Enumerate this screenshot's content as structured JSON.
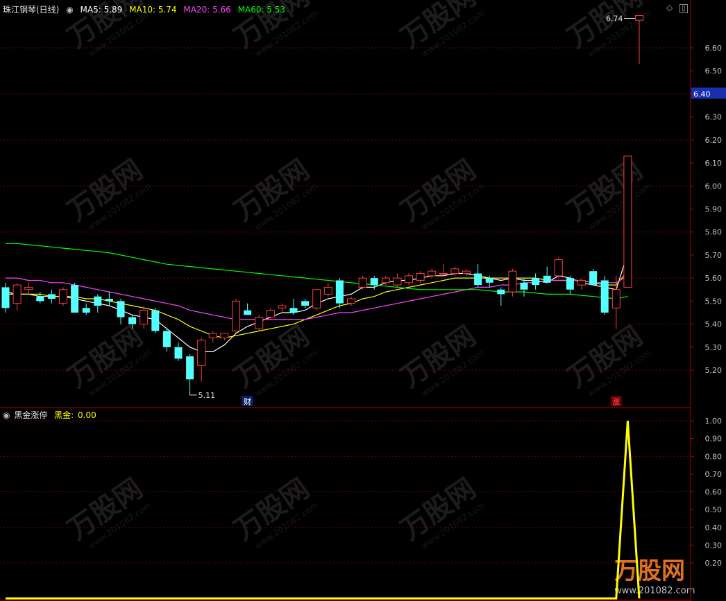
{
  "main_panel": {
    "title": "珠江钢琴(日线)",
    "ma_legend": [
      {
        "label": "MA5: 5.89",
        "color": "#ffffff"
      },
      {
        "label": "MA10: 5.74",
        "color": "#ffff00"
      },
      {
        "label": "MA20: 5.66",
        "color": "#ff44ff"
      },
      {
        "label": "MA60: 5.53",
        "color": "#00ff00"
      }
    ],
    "price_axis": {
      "min": 5.11,
      "max": 6.74,
      "ticks": [
        "6.60",
        "6.50",
        "6.40",
        "6.30",
        "6.20",
        "6.10",
        "6.00",
        "5.90",
        "5.80",
        "5.70",
        "5.60",
        "5.50",
        "5.40",
        "5.30",
        "5.20"
      ]
    },
    "current_price_label": "6.40",
    "high_label": "6.74",
    "low_label": "5.11",
    "markers": [
      {
        "text": "财",
        "candle_index": 21
      },
      {
        "text": "涨",
        "candle_index": 53
      }
    ]
  },
  "sub_panel": {
    "title": "黑金涨停",
    "value_label": "黑金:",
    "value_text": "0.00",
    "axis": {
      "ticks": [
        "1.00",
        "0.90",
        "0.80",
        "0.70",
        "0.60",
        "0.50",
        "0.40",
        "0.30",
        "0.20"
      ]
    }
  },
  "watermark": {
    "text": "万股网",
    "url": "www.201082.com"
  },
  "colors": {
    "up": "#ff3c3c",
    "down": "#54ffff",
    "grid": "#7a0000",
    "axis_text": "#c0c0c0",
    "ma5": "#ffffff",
    "ma10": "#ffff00",
    "ma20": "#ff44ff",
    "ma60": "#00ff00",
    "indicator": "#ffff00"
  },
  "chart_data": [
    {
      "type": "candlestick",
      "title": "珠江钢琴(日线)",
      "ylim": [
        5.11,
        6.74
      ],
      "candles": [
        {
          "o": 5.56,
          "h": 5.58,
          "l": 5.45,
          "c": 5.47
        },
        {
          "o": 5.49,
          "h": 5.58,
          "l": 5.46,
          "c": 5.57
        },
        {
          "o": 5.55,
          "h": 5.58,
          "l": 5.53,
          "c": 5.56
        },
        {
          "o": 5.52,
          "h": 5.54,
          "l": 5.49,
          "c": 5.5
        },
        {
          "o": 5.53,
          "h": 5.55,
          "l": 5.49,
          "c": 5.51
        },
        {
          "o": 5.49,
          "h": 5.56,
          "l": 5.48,
          "c": 5.55
        },
        {
          "o": 5.57,
          "h": 5.58,
          "l": 5.45,
          "c": 5.45
        },
        {
          "o": 5.47,
          "h": 5.49,
          "l": 5.44,
          "c": 5.45
        },
        {
          "o": 5.52,
          "h": 5.53,
          "l": 5.45,
          "c": 5.48
        },
        {
          "o": 5.51,
          "h": 5.54,
          "l": 5.48,
          "c": 5.5
        },
        {
          "o": 5.5,
          "h": 5.51,
          "l": 5.4,
          "c": 5.43
        },
        {
          "o": 5.43,
          "h": 5.44,
          "l": 5.38,
          "c": 5.4
        },
        {
          "o": 5.4,
          "h": 5.48,
          "l": 5.38,
          "c": 5.46
        },
        {
          "o": 5.46,
          "h": 5.47,
          "l": 5.36,
          "c": 5.37
        },
        {
          "o": 5.37,
          "h": 5.38,
          "l": 5.28,
          "c": 5.3
        },
        {
          "o": 5.3,
          "h": 5.32,
          "l": 5.24,
          "c": 5.25
        },
        {
          "o": 5.26,
          "h": 5.27,
          "l": 5.11,
          "c": 5.16
        },
        {
          "o": 5.22,
          "h": 5.34,
          "l": 5.15,
          "c": 5.33
        },
        {
          "o": 5.34,
          "h": 5.37,
          "l": 5.32,
          "c": 5.36
        },
        {
          "o": 5.34,
          "h": 5.36,
          "l": 5.33,
          "c": 5.36
        },
        {
          "o": 5.37,
          "h": 5.51,
          "l": 5.36,
          "c": 5.5
        },
        {
          "o": 5.46,
          "h": 5.49,
          "l": 5.44,
          "c": 5.44
        },
        {
          "o": 5.38,
          "h": 5.44,
          "l": 5.37,
          "c": 5.43
        },
        {
          "o": 5.43,
          "h": 5.47,
          "l": 5.42,
          "c": 5.46
        },
        {
          "o": 5.47,
          "h": 5.49,
          "l": 5.45,
          "c": 5.48
        },
        {
          "o": 5.47,
          "h": 5.51,
          "l": 5.44,
          "c": 5.45
        },
        {
          "o": 5.5,
          "h": 5.51,
          "l": 5.47,
          "c": 5.48
        },
        {
          "o": 5.47,
          "h": 5.55,
          "l": 5.46,
          "c": 5.55
        },
        {
          "o": 5.53,
          "h": 5.58,
          "l": 5.52,
          "c": 5.56
        },
        {
          "o": 5.59,
          "h": 5.6,
          "l": 5.47,
          "c": 5.49
        },
        {
          "o": 5.49,
          "h": 5.52,
          "l": 5.48,
          "c": 5.51
        },
        {
          "o": 5.56,
          "h": 5.61,
          "l": 5.55,
          "c": 5.6
        },
        {
          "o": 5.6,
          "h": 5.61,
          "l": 5.55,
          "c": 5.57
        },
        {
          "o": 5.58,
          "h": 5.61,
          "l": 5.57,
          "c": 5.6
        },
        {
          "o": 5.57,
          "h": 5.62,
          "l": 5.56,
          "c": 5.6
        },
        {
          "o": 5.58,
          "h": 5.62,
          "l": 5.57,
          "c": 5.61
        },
        {
          "o": 5.59,
          "h": 5.63,
          "l": 5.58,
          "c": 5.62
        },
        {
          "o": 5.61,
          "h": 5.64,
          "l": 5.6,
          "c": 5.63
        },
        {
          "o": 5.62,
          "h": 5.66,
          "l": 5.61,
          "c": 5.62
        },
        {
          "o": 5.62,
          "h": 5.65,
          "l": 5.61,
          "c": 5.64
        },
        {
          "o": 5.62,
          "h": 5.64,
          "l": 5.61,
          "c": 5.63
        },
        {
          "o": 5.62,
          "h": 5.66,
          "l": 5.56,
          "c": 5.57
        },
        {
          "o": 5.6,
          "h": 5.61,
          "l": 5.56,
          "c": 5.58
        },
        {
          "o": 5.55,
          "h": 5.56,
          "l": 5.48,
          "c": 5.53
        },
        {
          "o": 5.54,
          "h": 5.64,
          "l": 5.52,
          "c": 5.63
        },
        {
          "o": 5.58,
          "h": 5.6,
          "l": 5.52,
          "c": 5.55
        },
        {
          "o": 5.6,
          "h": 5.62,
          "l": 5.55,
          "c": 5.57
        },
        {
          "o": 5.61,
          "h": 5.65,
          "l": 5.58,
          "c": 5.58
        },
        {
          "o": 5.61,
          "h": 5.69,
          "l": 5.6,
          "c": 5.68
        },
        {
          "o": 5.6,
          "h": 5.61,
          "l": 5.53,
          "c": 5.55
        },
        {
          "o": 5.57,
          "h": 5.6,
          "l": 5.55,
          "c": 5.59
        },
        {
          "o": 5.63,
          "h": 5.64,
          "l": 5.57,
          "c": 5.57
        },
        {
          "o": 5.59,
          "h": 5.61,
          "l": 5.44,
          "c": 5.45
        },
        {
          "o": 5.47,
          "h": 5.61,
          "l": 5.38,
          "c": 5.55
        },
        {
          "o": 5.56,
          "h": 6.13,
          "l": 5.56,
          "c": 6.13
        },
        {
          "o": 6.72,
          "h": 6.74,
          "l": 6.53,
          "c": 6.74
        }
      ],
      "ma_series": [
        {
          "name": "MA5",
          "values": [
            5.54,
            5.53,
            5.53,
            5.52,
            5.52,
            5.52,
            5.51,
            5.5,
            5.49,
            5.48,
            5.46,
            5.44,
            5.43,
            5.42,
            5.38,
            5.34,
            5.3,
            5.28,
            5.28,
            5.31,
            5.36,
            5.39,
            5.41,
            5.43,
            5.45,
            5.45,
            5.46,
            5.49,
            5.51,
            5.52,
            5.53,
            5.56,
            5.56,
            5.58,
            5.59,
            5.59,
            5.6,
            5.61,
            5.61,
            5.62,
            5.62,
            5.61,
            5.6,
            5.59,
            5.6,
            5.59,
            5.59,
            5.58,
            5.61,
            5.6,
            5.58,
            5.57,
            5.56,
            5.55,
            5.71,
            5.89
          ]
        },
        {
          "name": "MA10",
          "values": [
            5.53,
            5.53,
            5.53,
            5.53,
            5.52,
            5.52,
            5.52,
            5.51,
            5.51,
            5.5,
            5.49,
            5.48,
            5.47,
            5.46,
            5.44,
            5.42,
            5.39,
            5.37,
            5.35,
            5.34,
            5.35,
            5.36,
            5.37,
            5.38,
            5.39,
            5.4,
            5.42,
            5.44,
            5.46,
            5.48,
            5.49,
            5.51,
            5.52,
            5.54,
            5.55,
            5.56,
            5.57,
            5.58,
            5.59,
            5.6,
            5.6,
            5.6,
            5.6,
            5.6,
            5.6,
            5.6,
            5.6,
            5.59,
            5.59,
            5.59,
            5.59,
            5.58,
            5.57,
            5.57,
            5.63,
            5.74
          ]
        },
        {
          "name": "MA20",
          "values": [
            5.6,
            5.6,
            5.59,
            5.59,
            5.58,
            5.58,
            5.57,
            5.56,
            5.55,
            5.54,
            5.53,
            5.52,
            5.51,
            5.5,
            5.49,
            5.48,
            5.46,
            5.45,
            5.44,
            5.43,
            5.42,
            5.42,
            5.42,
            5.42,
            5.42,
            5.42,
            5.42,
            5.43,
            5.44,
            5.45,
            5.45,
            5.46,
            5.47,
            5.48,
            5.49,
            5.5,
            5.51,
            5.52,
            5.53,
            5.54,
            5.55,
            5.56,
            5.56,
            5.57,
            5.57,
            5.58,
            5.58,
            5.59,
            5.59,
            5.59,
            5.59,
            5.58,
            5.58,
            5.58,
            5.61,
            5.66
          ]
        },
        {
          "name": "MA60",
          "values": [
            5.75,
            5.75,
            5.745,
            5.74,
            5.735,
            5.73,
            5.725,
            5.72,
            5.715,
            5.71,
            5.7,
            5.69,
            5.68,
            5.67,
            5.66,
            5.655,
            5.65,
            5.645,
            5.64,
            5.635,
            5.63,
            5.625,
            5.62,
            5.615,
            5.61,
            5.605,
            5.6,
            5.595,
            5.59,
            5.585,
            5.58,
            5.575,
            5.57,
            5.565,
            5.56,
            5.555,
            5.55,
            5.55,
            5.55,
            5.55,
            5.55,
            5.55,
            5.545,
            5.54,
            5.54,
            5.54,
            5.535,
            5.53,
            5.53,
            5.53,
            5.525,
            5.52,
            5.515,
            5.51,
            5.52,
            5.53
          ]
        }
      ]
    },
    {
      "type": "line",
      "title": "黑金涨停",
      "ylim": [
        0,
        1.0
      ],
      "series": [
        {
          "name": "黑金",
          "values": [
            0,
            0,
            0,
            0,
            0,
            0,
            0,
            0,
            0,
            0,
            0,
            0,
            0,
            0,
            0,
            0,
            0,
            0,
            0,
            0,
            0,
            0,
            0,
            0,
            0,
            0,
            0,
            0,
            0,
            0,
            0,
            0,
            0,
            0,
            0,
            0,
            0,
            0,
            0,
            0,
            0,
            0,
            0,
            0,
            0,
            0,
            0,
            0,
            0,
            0,
            0,
            0,
            0,
            0,
            1,
            0
          ]
        }
      ]
    }
  ]
}
